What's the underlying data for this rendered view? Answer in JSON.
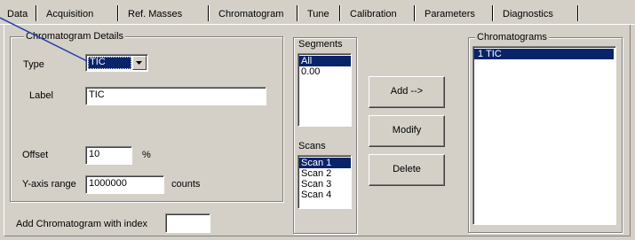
{
  "tabs": [
    {
      "label": "Data"
    },
    {
      "label": "Acquisition"
    },
    {
      "label": "Ref. Masses"
    },
    {
      "label": "Chromatogram"
    },
    {
      "label": "Tune"
    },
    {
      "label": "Calibration"
    },
    {
      "label": "Parameters"
    },
    {
      "label": "Diagnostics"
    }
  ],
  "details": {
    "title": "Chromatogram Details",
    "type_label": "Type",
    "type_value": "TIC",
    "label_label": "Label",
    "label_value": "TIC",
    "offset_label": "Offset",
    "offset_value": "10",
    "offset_unit": "%",
    "yrange_label": "Y-axis range",
    "yrange_value": "1000000",
    "yrange_unit": "counts"
  },
  "segments": {
    "title": "Segments",
    "items": [
      {
        "label": "All",
        "selected": true
      },
      {
        "label": "0.00",
        "selected": false
      }
    ]
  },
  "scans": {
    "title": "Scans",
    "items": [
      {
        "label": "Scan 1",
        "selected": true
      },
      {
        "label": "Scan 2",
        "selected": false
      },
      {
        "label": "Scan 3",
        "selected": false
      },
      {
        "label": "Scan 4",
        "selected": false
      }
    ]
  },
  "buttons": {
    "add": "Add -->",
    "modify": "Modify",
    "delete": "Delete"
  },
  "chromatograms": {
    "title": "Chromatograms",
    "items": [
      {
        "label": "1  TIC",
        "selected": true
      }
    ]
  },
  "add_index": {
    "label": "Add Chromatogram with index",
    "value": ""
  },
  "colors": {
    "face": "#d4d0c8",
    "selection": "#0a246a",
    "annotation_line": "#1f3ea8"
  }
}
